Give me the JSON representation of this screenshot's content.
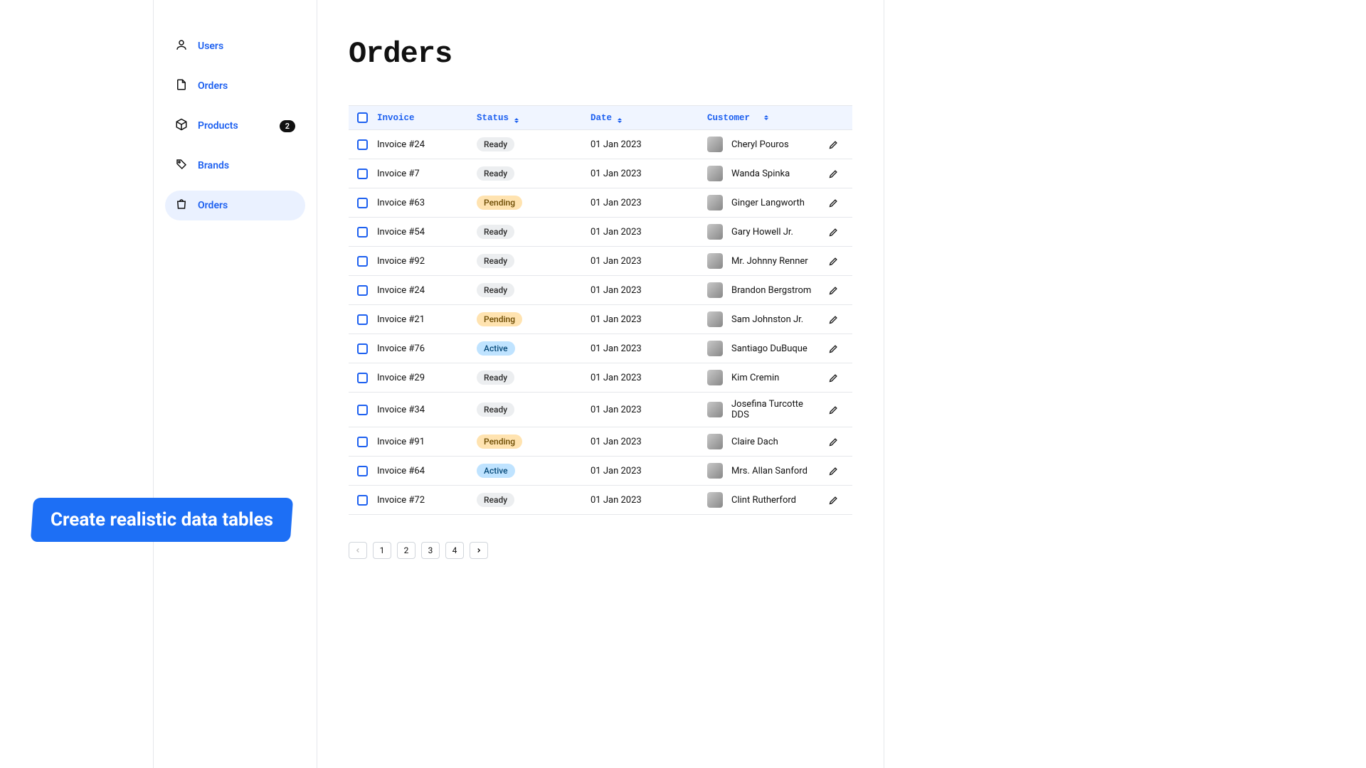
{
  "page_title": "Orders",
  "promo_text": "Create realistic data tables",
  "sidebar": {
    "items": [
      {
        "label": "Users",
        "icon": "user",
        "active": false,
        "badge": null
      },
      {
        "label": "Orders",
        "icon": "file",
        "active": false,
        "badge": null
      },
      {
        "label": "Products",
        "icon": "box",
        "active": false,
        "badge": "2"
      },
      {
        "label": "Brands",
        "icon": "tag",
        "active": false,
        "badge": null
      },
      {
        "label": "Orders",
        "icon": "bag",
        "active": true,
        "badge": null
      }
    ]
  },
  "columns": {
    "invoice": "Invoice",
    "status": "Status",
    "date": "Date",
    "customer": "Customer"
  },
  "rows": [
    {
      "invoice": "Invoice #24",
      "status": "Ready",
      "date": "01 Jan 2023",
      "customer": "Cheryl Pouros"
    },
    {
      "invoice": "Invoice #7",
      "status": "Ready",
      "date": "01 Jan 2023",
      "customer": "Wanda Spinka"
    },
    {
      "invoice": "Invoice #63",
      "status": "Pending",
      "date": "01 Jan 2023",
      "customer": "Ginger Langworth"
    },
    {
      "invoice": "Invoice #54",
      "status": "Ready",
      "date": "01 Jan 2023",
      "customer": "Gary Howell Jr."
    },
    {
      "invoice": "Invoice #92",
      "status": "Ready",
      "date": "01 Jan 2023",
      "customer": "Mr. Johnny Renner"
    },
    {
      "invoice": "Invoice #24",
      "status": "Ready",
      "date": "01 Jan 2023",
      "customer": "Brandon Bergstrom"
    },
    {
      "invoice": "Invoice #21",
      "status": "Pending",
      "date": "01 Jan 2023",
      "customer": "Sam Johnston Jr."
    },
    {
      "invoice": "Invoice #76",
      "status": "Active",
      "date": "01 Jan 2023",
      "customer": "Santiago DuBuque"
    },
    {
      "invoice": "Invoice #29",
      "status": "Ready",
      "date": "01 Jan 2023",
      "customer": "Kim Cremin"
    },
    {
      "invoice": "Invoice #34",
      "status": "Ready",
      "date": "01 Jan 2023",
      "customer": "Josefina Turcotte DDS"
    },
    {
      "invoice": "Invoice #91",
      "status": "Pending",
      "date": "01 Jan 2023",
      "customer": "Claire Dach"
    },
    {
      "invoice": "Invoice #64",
      "status": "Active",
      "date": "01 Jan 2023",
      "customer": "Mrs. Allan Sanford"
    },
    {
      "invoice": "Invoice #72",
      "status": "Ready",
      "date": "01 Jan 2023",
      "customer": "Clint Rutherford"
    }
  ],
  "pagination": {
    "prev": "‹",
    "pages": [
      "1",
      "2",
      "3",
      "4"
    ],
    "next": "›"
  }
}
